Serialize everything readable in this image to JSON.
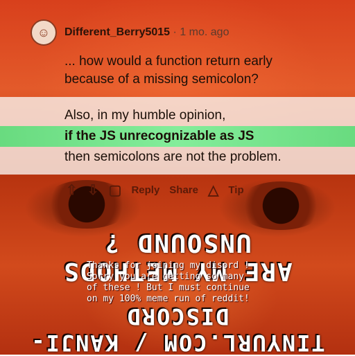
{
  "comment": {
    "username": "Different_Berry5015",
    "separator": "·",
    "time": "1 mo. ago",
    "lines": [
      "... how would a function return early",
      "because of a missing semicolon?"
    ],
    "para2_line1": "Also, in my humble opinion,",
    "para2_line2": "if the JS unrecognizable as JS",
    "para2_line3": "then semicolons are not the problem."
  },
  "actions": {
    "upvote_icon": "arrow-up-icon",
    "downvote_icon": "arrow-down-icon",
    "reply_icon": "chat-bubble-icon",
    "reply_label": "Reply",
    "share_label": "Share",
    "award_label": "Tip"
  },
  "overlay": {
    "top_banner": "ARE MY METHODS UNSOUND ?",
    "message_lines": "Thanks for joining my disord !\nSorry you are getting so many\nof these ! But I must continue\non my 100% meme run of reddit!",
    "bottom_banner": "TINYURL.COM / KANJI-DISCORD"
  }
}
